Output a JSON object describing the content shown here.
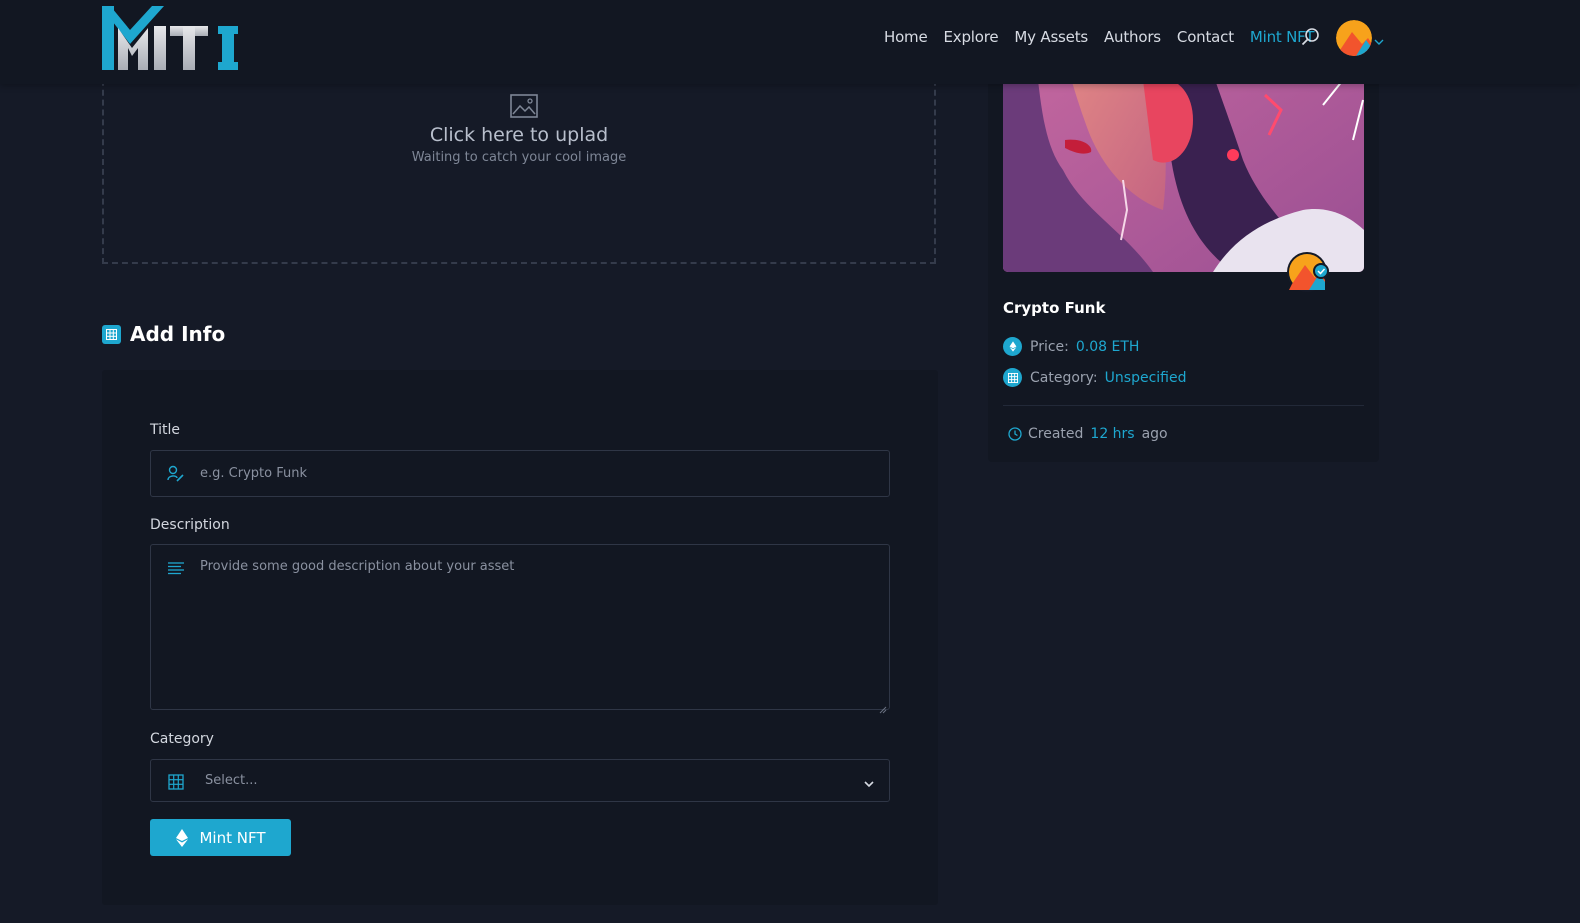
{
  "brand": {
    "logo_text": "MITI"
  },
  "nav": {
    "links": [
      "Home",
      "Explore",
      "My Assets",
      "Authors",
      "Contact",
      "Mint NFT"
    ],
    "active": "Mint NFT"
  },
  "upload": {
    "title": "Click here to uplad",
    "subtitle": "Waiting to catch your cool image"
  },
  "form": {
    "section_title": "Add Info",
    "title_label": "Title",
    "title_placeholder": "e.g. Crypto Funk",
    "title_value": "",
    "description_label": "Description",
    "description_placeholder": "Provide some good description about your asset",
    "description_value": "",
    "category_label": "Category",
    "category_selected": "Select...",
    "submit_label": "Mint NFT"
  },
  "preview": {
    "name": "Crypto Funk",
    "price_label": "Price:",
    "price_value": "0.08 ETH",
    "category_label": "Category:",
    "category_value": "Unspecified",
    "created_label": "Created",
    "created_value": "12 hrs",
    "created_suffix": "ago"
  },
  "icons": {
    "search": "search-icon",
    "upload": "image-icon",
    "title_field": "user-edit-icon",
    "description_field": "align-left-icon",
    "category_field": "grid-icon",
    "mint_button": "ethereum-icon",
    "price": "ethereum-icon",
    "category": "grid-icon",
    "created": "clock-icon"
  },
  "colors": {
    "accent": "#1ea7cf",
    "background": "#151a27",
    "card": "#121722"
  }
}
